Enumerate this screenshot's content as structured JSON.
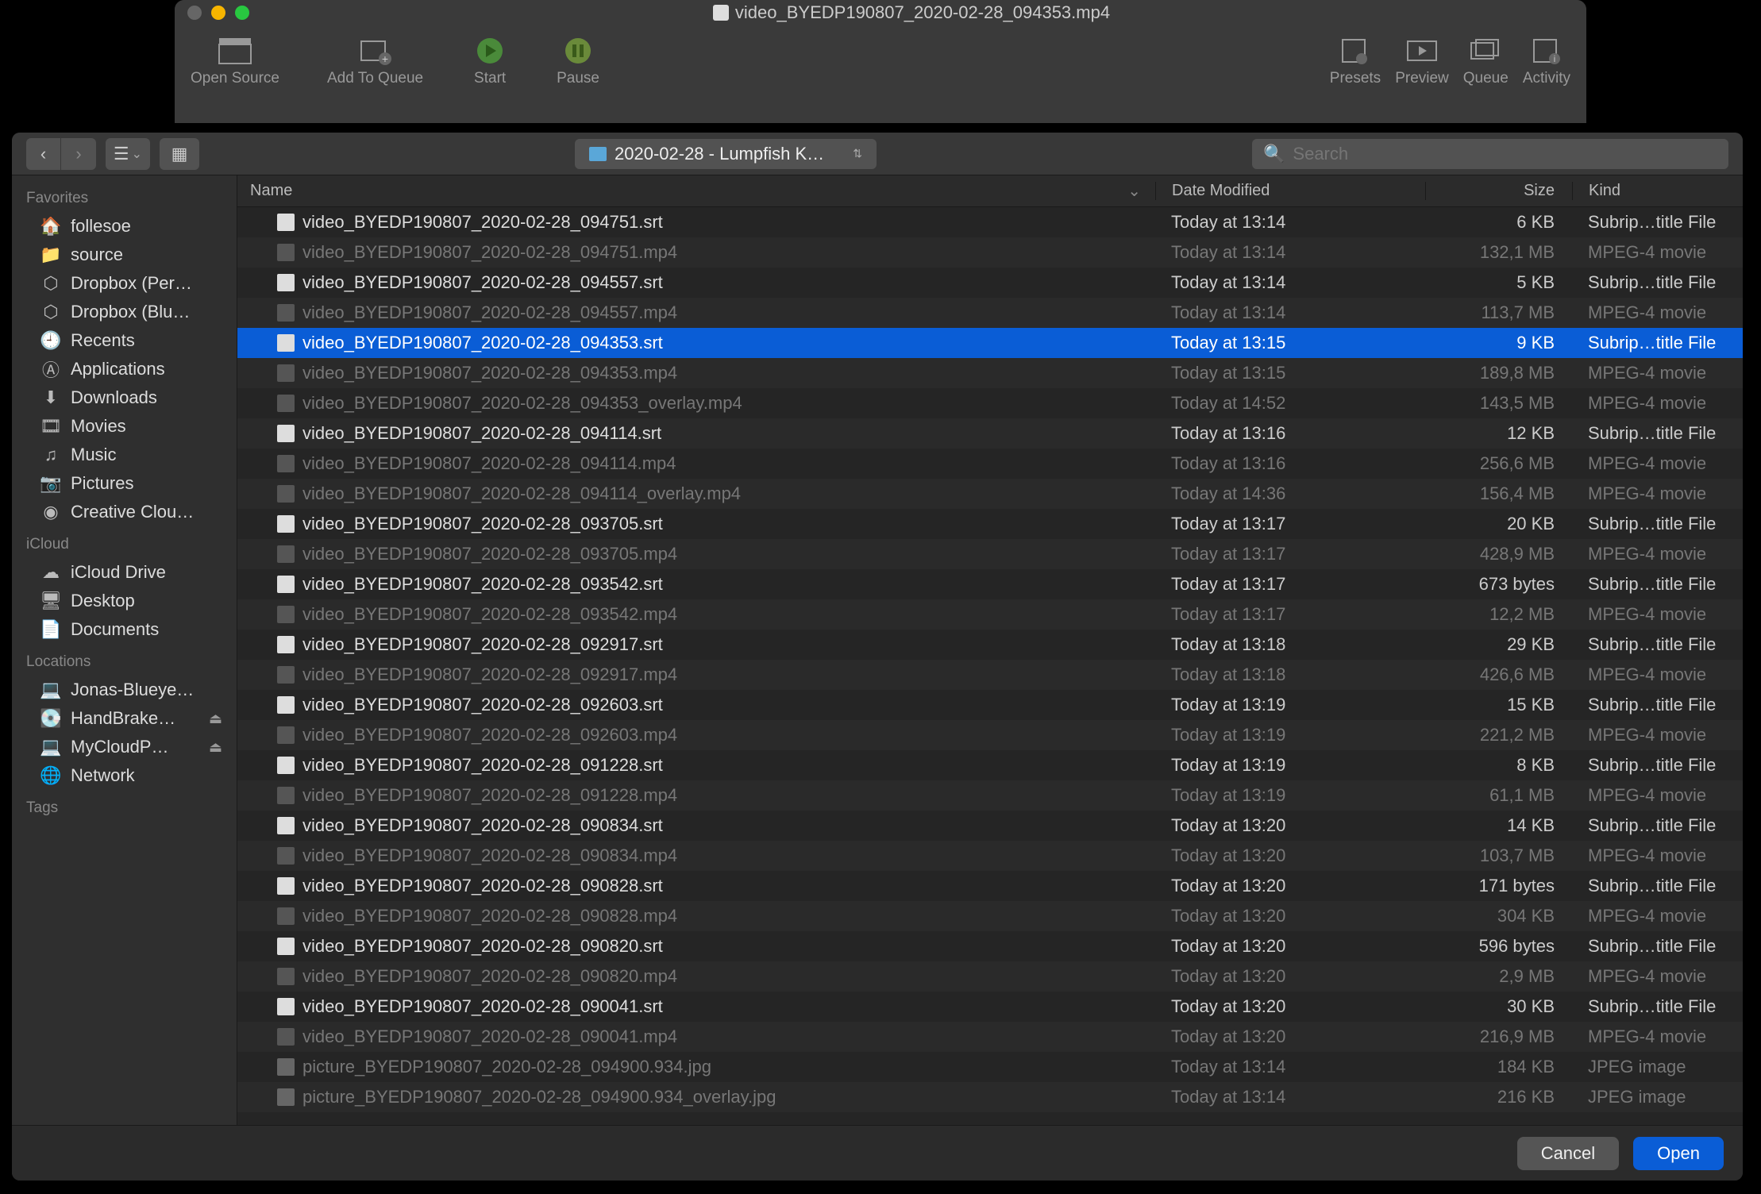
{
  "window": {
    "title": "video_BYEDP190807_2020-02-28_094353.mp4"
  },
  "toolbar": {
    "open_source": "Open Source",
    "add_to_queue": "Add To Queue",
    "start": "Start",
    "pause": "Pause",
    "presets": "Presets",
    "preview": "Preview",
    "queue": "Queue",
    "activity": "Activity"
  },
  "dialog": {
    "path": "2020-02-28 - Lumpfish K…",
    "search_placeholder": "Search",
    "cancel": "Cancel",
    "open": "Open"
  },
  "columns": {
    "name": "Name",
    "date": "Date Modified",
    "size": "Size",
    "kind": "Kind"
  },
  "sidebar": {
    "favorites_label": "Favorites",
    "favorites": [
      {
        "icon": "home",
        "label": "follesoe"
      },
      {
        "icon": "folder",
        "label": "source"
      },
      {
        "icon": "dropbox",
        "label": "Dropbox (Per…"
      },
      {
        "icon": "dropbox",
        "label": "Dropbox (Blu…"
      },
      {
        "icon": "clock",
        "label": "Recents"
      },
      {
        "icon": "app",
        "label": "Applications"
      },
      {
        "icon": "down",
        "label": "Downloads"
      },
      {
        "icon": "film",
        "label": "Movies"
      },
      {
        "icon": "music",
        "label": "Music"
      },
      {
        "icon": "camera",
        "label": "Pictures"
      },
      {
        "icon": "cc",
        "label": "Creative Clou…"
      }
    ],
    "icloud_label": "iCloud",
    "icloud": [
      {
        "icon": "cloud",
        "label": "iCloud Drive"
      },
      {
        "icon": "desktop",
        "label": "Desktop"
      },
      {
        "icon": "doc",
        "label": "Documents"
      }
    ],
    "locations_label": "Locations",
    "locations": [
      {
        "icon": "laptop",
        "label": "Jonas-Blueye…",
        "eject": false
      },
      {
        "icon": "disk",
        "label": "HandBrake…",
        "eject": true
      },
      {
        "icon": "laptop",
        "label": "MyCloudP…",
        "eject": true
      },
      {
        "icon": "globe",
        "label": "Network",
        "eject": false
      }
    ],
    "tags_label": "Tags"
  },
  "files": [
    {
      "type": "srt",
      "name": "video_BYEDP190807_2020-02-28_094751.srt",
      "date": "Today at 13:14",
      "size": "6 KB",
      "kind": "Subrip…title File",
      "dim": false,
      "selected": false
    },
    {
      "type": "mp4",
      "name": "video_BYEDP190807_2020-02-28_094751.mp4",
      "date": "Today at 13:14",
      "size": "132,1 MB",
      "kind": "MPEG-4 movie",
      "dim": true,
      "selected": false
    },
    {
      "type": "srt",
      "name": "video_BYEDP190807_2020-02-28_094557.srt",
      "date": "Today at 13:14",
      "size": "5 KB",
      "kind": "Subrip…title File",
      "dim": false,
      "selected": false
    },
    {
      "type": "mp4",
      "name": "video_BYEDP190807_2020-02-28_094557.mp4",
      "date": "Today at 13:14",
      "size": "113,7 MB",
      "kind": "MPEG-4 movie",
      "dim": true,
      "selected": false
    },
    {
      "type": "srt",
      "name": "video_BYEDP190807_2020-02-28_094353.srt",
      "date": "Today at 13:15",
      "size": "9 KB",
      "kind": "Subrip…title File",
      "dim": false,
      "selected": true
    },
    {
      "type": "mp4",
      "name": "video_BYEDP190807_2020-02-28_094353.mp4",
      "date": "Today at 13:15",
      "size": "189,8 MB",
      "kind": "MPEG-4 movie",
      "dim": true,
      "selected": false
    },
    {
      "type": "mp4",
      "name": "video_BYEDP190807_2020-02-28_094353_overlay.mp4",
      "date": "Today at 14:52",
      "size": "143,5 MB",
      "kind": "MPEG-4 movie",
      "dim": true,
      "selected": false
    },
    {
      "type": "srt",
      "name": "video_BYEDP190807_2020-02-28_094114.srt",
      "date": "Today at 13:16",
      "size": "12 KB",
      "kind": "Subrip…title File",
      "dim": false,
      "selected": false
    },
    {
      "type": "mp4",
      "name": "video_BYEDP190807_2020-02-28_094114.mp4",
      "date": "Today at 13:16",
      "size": "256,6 MB",
      "kind": "MPEG-4 movie",
      "dim": true,
      "selected": false
    },
    {
      "type": "mp4",
      "name": "video_BYEDP190807_2020-02-28_094114_overlay.mp4",
      "date": "Today at 14:36",
      "size": "156,4 MB",
      "kind": "MPEG-4 movie",
      "dim": true,
      "selected": false
    },
    {
      "type": "srt",
      "name": "video_BYEDP190807_2020-02-28_093705.srt",
      "date": "Today at 13:17",
      "size": "20 KB",
      "kind": "Subrip…title File",
      "dim": false,
      "selected": false
    },
    {
      "type": "mp4",
      "name": "video_BYEDP190807_2020-02-28_093705.mp4",
      "date": "Today at 13:17",
      "size": "428,9 MB",
      "kind": "MPEG-4 movie",
      "dim": true,
      "selected": false
    },
    {
      "type": "srt",
      "name": "video_BYEDP190807_2020-02-28_093542.srt",
      "date": "Today at 13:17",
      "size": "673 bytes",
      "kind": "Subrip…title File",
      "dim": false,
      "selected": false
    },
    {
      "type": "mp4",
      "name": "video_BYEDP190807_2020-02-28_093542.mp4",
      "date": "Today at 13:17",
      "size": "12,2 MB",
      "kind": "MPEG-4 movie",
      "dim": true,
      "selected": false
    },
    {
      "type": "srt",
      "name": "video_BYEDP190807_2020-02-28_092917.srt",
      "date": "Today at 13:18",
      "size": "29 KB",
      "kind": "Subrip…title File",
      "dim": false,
      "selected": false
    },
    {
      "type": "mp4",
      "name": "video_BYEDP190807_2020-02-28_092917.mp4",
      "date": "Today at 13:18",
      "size": "426,6 MB",
      "kind": "MPEG-4 movie",
      "dim": true,
      "selected": false
    },
    {
      "type": "srt",
      "name": "video_BYEDP190807_2020-02-28_092603.srt",
      "date": "Today at 13:19",
      "size": "15 KB",
      "kind": "Subrip…title File",
      "dim": false,
      "selected": false
    },
    {
      "type": "mp4",
      "name": "video_BYEDP190807_2020-02-28_092603.mp4",
      "date": "Today at 13:19",
      "size": "221,2 MB",
      "kind": "MPEG-4 movie",
      "dim": true,
      "selected": false
    },
    {
      "type": "srt",
      "name": "video_BYEDP190807_2020-02-28_091228.srt",
      "date": "Today at 13:19",
      "size": "8 KB",
      "kind": "Subrip…title File",
      "dim": false,
      "selected": false
    },
    {
      "type": "mp4",
      "name": "video_BYEDP190807_2020-02-28_091228.mp4",
      "date": "Today at 13:19",
      "size": "61,1 MB",
      "kind": "MPEG-4 movie",
      "dim": true,
      "selected": false
    },
    {
      "type": "srt",
      "name": "video_BYEDP190807_2020-02-28_090834.srt",
      "date": "Today at 13:20",
      "size": "14 KB",
      "kind": "Subrip…title File",
      "dim": false,
      "selected": false
    },
    {
      "type": "mp4",
      "name": "video_BYEDP190807_2020-02-28_090834.mp4",
      "date": "Today at 13:20",
      "size": "103,7 MB",
      "kind": "MPEG-4 movie",
      "dim": true,
      "selected": false
    },
    {
      "type": "srt",
      "name": "video_BYEDP190807_2020-02-28_090828.srt",
      "date": "Today at 13:20",
      "size": "171 bytes",
      "kind": "Subrip…title File",
      "dim": false,
      "selected": false
    },
    {
      "type": "mp4",
      "name": "video_BYEDP190807_2020-02-28_090828.mp4",
      "date": "Today at 13:20",
      "size": "304 KB",
      "kind": "MPEG-4 movie",
      "dim": true,
      "selected": false
    },
    {
      "type": "srt",
      "name": "video_BYEDP190807_2020-02-28_090820.srt",
      "date": "Today at 13:20",
      "size": "596 bytes",
      "kind": "Subrip…title File",
      "dim": false,
      "selected": false
    },
    {
      "type": "mp4",
      "name": "video_BYEDP190807_2020-02-28_090820.mp4",
      "date": "Today at 13:20",
      "size": "2,9 MB",
      "kind": "MPEG-4 movie",
      "dim": true,
      "selected": false
    },
    {
      "type": "srt",
      "name": "video_BYEDP190807_2020-02-28_090041.srt",
      "date": "Today at 13:20",
      "size": "30 KB",
      "kind": "Subrip…title File",
      "dim": false,
      "selected": false
    },
    {
      "type": "mp4",
      "name": "video_BYEDP190807_2020-02-28_090041.mp4",
      "date": "Today at 13:20",
      "size": "216,9 MB",
      "kind": "MPEG-4 movie",
      "dim": true,
      "selected": false
    },
    {
      "type": "jpg",
      "name": "picture_BYEDP190807_2020-02-28_094900.934.jpg",
      "date": "Today at 13:14",
      "size": "184 KB",
      "kind": "JPEG image",
      "dim": true,
      "selected": false
    },
    {
      "type": "jpg",
      "name": "picture_BYEDP190807_2020-02-28_094900.934_overlay.jpg",
      "date": "Today at 13:14",
      "size": "216 KB",
      "kind": "JPEG image",
      "dim": true,
      "selected": false
    }
  ]
}
